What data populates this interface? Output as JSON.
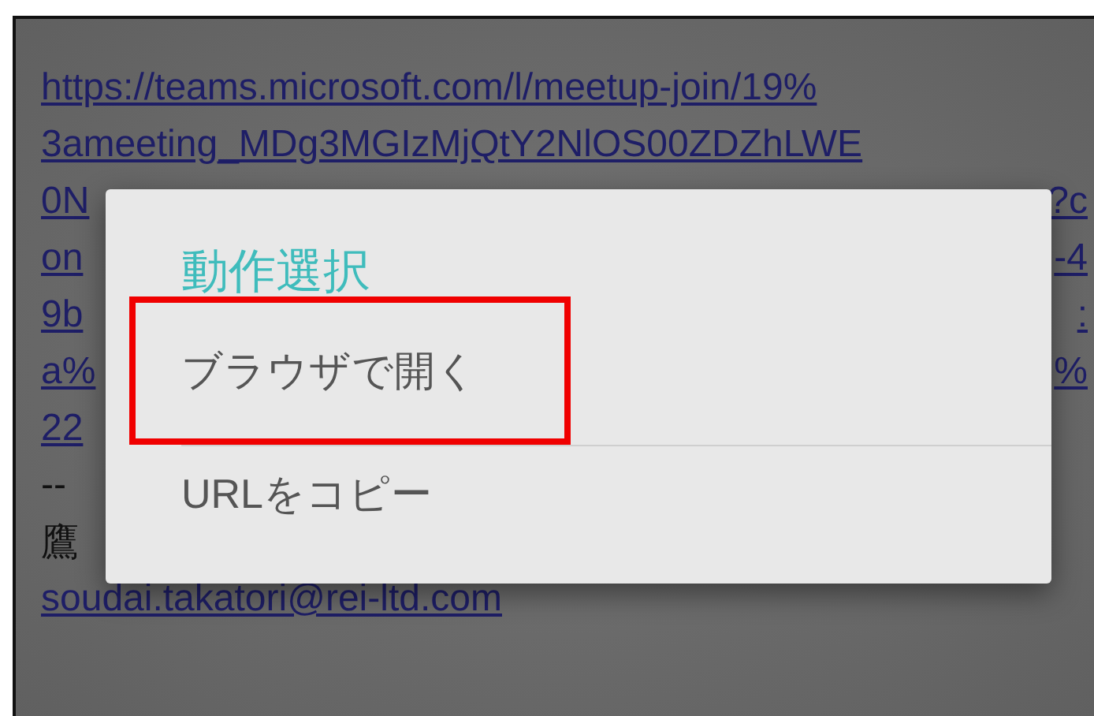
{
  "message": {
    "lines": [
      {
        "kind": "link",
        "parts": [
          "https://teams.microsoft.com/l/meetup-join/19%"
        ]
      },
      {
        "kind": "link",
        "parts": [
          "3ameeting_MDg3MGIzMjQtY2NlOS00ZDZhLWE"
        ]
      },
      {
        "kind": "link",
        "parts": [
          "0N",
          "?c"
        ]
      },
      {
        "kind": "link",
        "parts": [
          "on",
          "-4"
        ]
      },
      {
        "kind": "link",
        "parts": [
          "9b",
          ":"
        ]
      },
      {
        "kind": "link",
        "parts": [
          "a%",
          "%"
        ]
      },
      {
        "kind": "link",
        "parts": [
          "22"
        ]
      },
      {
        "kind": "text",
        "parts": [
          "--"
        ]
      },
      {
        "kind": "text",
        "parts": [
          "鷹"
        ]
      },
      {
        "kind": "link",
        "parts": [
          "soudai.takatori@rei-ltd.com"
        ]
      }
    ]
  },
  "dialog": {
    "title": "動作選択",
    "items": [
      {
        "label": "ブラウザで開く",
        "highlighted": true
      },
      {
        "label": "URLをコピー",
        "highlighted": false
      }
    ]
  }
}
